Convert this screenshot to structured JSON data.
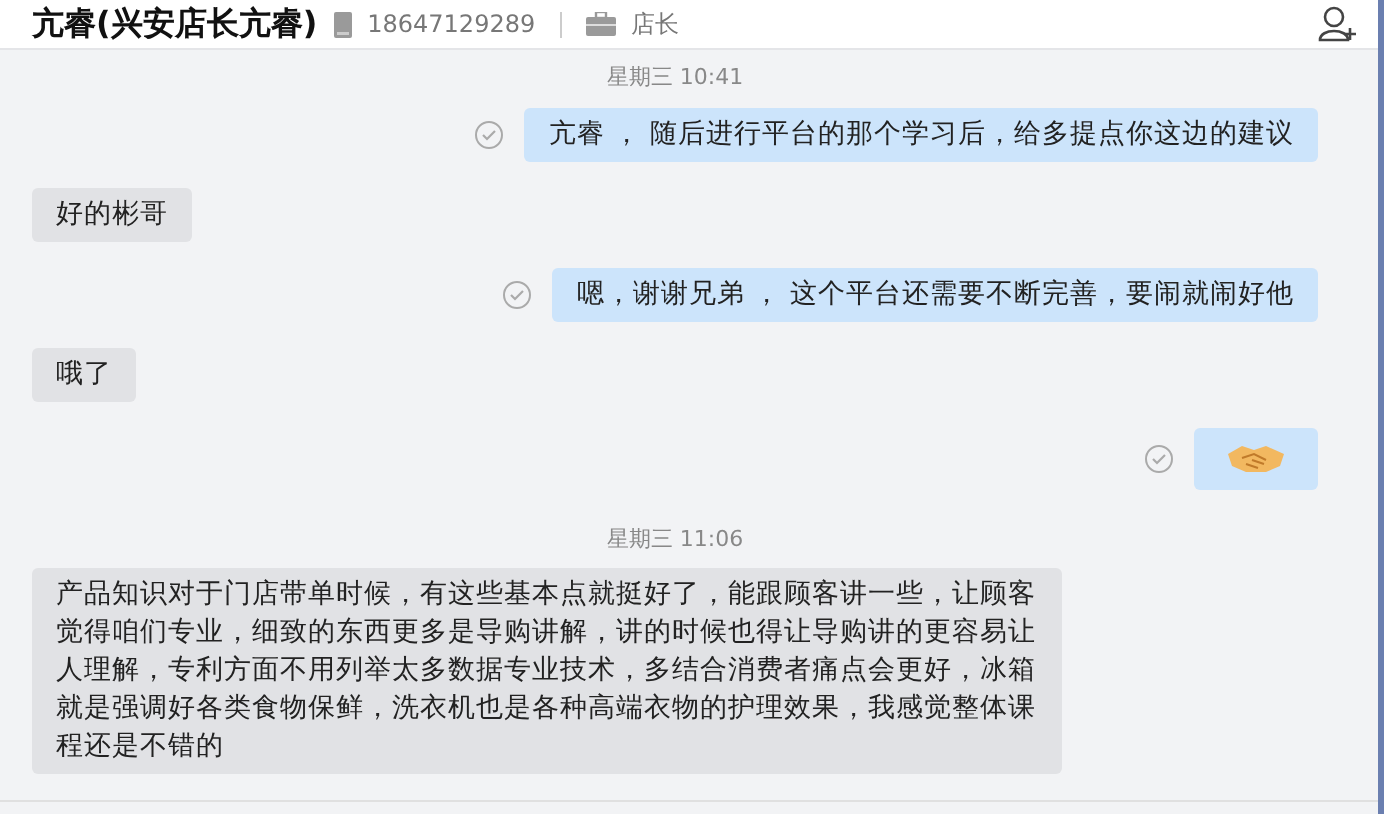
{
  "header": {
    "title": "亢睿(兴安店长亢睿)",
    "phone": "18647129289",
    "role": "店长"
  },
  "messages": [
    {
      "kind": "time",
      "text": "星期三 10:41"
    },
    {
      "kind": "text",
      "outgoing": true,
      "text": "亢睿 ，  随后进行平台的那个学习后，给多提点你这边的建议"
    },
    {
      "kind": "text",
      "outgoing": false,
      "text": "好的彬哥"
    },
    {
      "kind": "text",
      "outgoing": true,
      "text": "嗯，谢谢兄弟 ，  这个平台还需要不断完善，要闹就闹好他"
    },
    {
      "kind": "text",
      "outgoing": false,
      "text": "哦了"
    },
    {
      "kind": "sticker",
      "outgoing": true
    },
    {
      "kind": "time",
      "text": "星期三 11:06"
    },
    {
      "kind": "text",
      "outgoing": false,
      "text": "产品知识对于门店带单时候，有这些基本点就挺好了，能跟顾客讲一些，让顾客觉得咱们专业，细致的东西更多是导购讲解，讲的时候也得让导购讲的更容易让人理解，专利方面不用列举太多数据专业技术，多结合消费者痛点会更好，冰箱就是强调好各类食物保鲜，洗衣机也是各种高端衣物的护理效果，我感觉整体课程还是不错的"
    }
  ]
}
